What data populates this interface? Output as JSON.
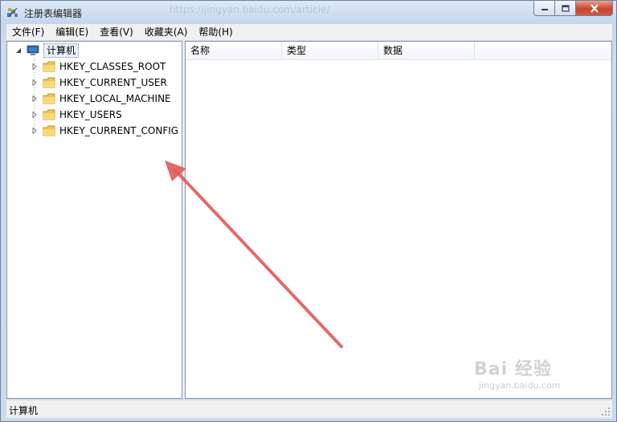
{
  "window": {
    "title": "注册表编辑器",
    "title_watermark": "https://jingyan.baidu.com/article/",
    "buttons": {
      "minimize": "minimize-icon",
      "maximize": "maximize-icon",
      "close": "close-icon"
    }
  },
  "menu": [
    {
      "label": "文件(F)"
    },
    {
      "label": "编辑(E)"
    },
    {
      "label": "查看(V)"
    },
    {
      "label": "收藏夹(A)"
    },
    {
      "label": "帮助(H)"
    }
  ],
  "tree": {
    "root": "计算机",
    "items": [
      {
        "label": "HKEY_CLASSES_ROOT"
      },
      {
        "label": "HKEY_CURRENT_USER"
      },
      {
        "label": "HKEY_LOCAL_MACHINE"
      },
      {
        "label": "HKEY_USERS"
      },
      {
        "label": "HKEY_CURRENT_CONFIG"
      }
    ]
  },
  "list": {
    "columns": [
      {
        "label": "名称"
      },
      {
        "label": "类型"
      },
      {
        "label": "数据"
      }
    ]
  },
  "status": {
    "path": "计算机"
  },
  "watermark": {
    "brand": "Bai 经验",
    "url": "jingyan.baidu.com"
  },
  "colors": {
    "annotation_arrow": "#e05a5a",
    "folder": "#f0c64a",
    "close_button": "#c7452c"
  }
}
